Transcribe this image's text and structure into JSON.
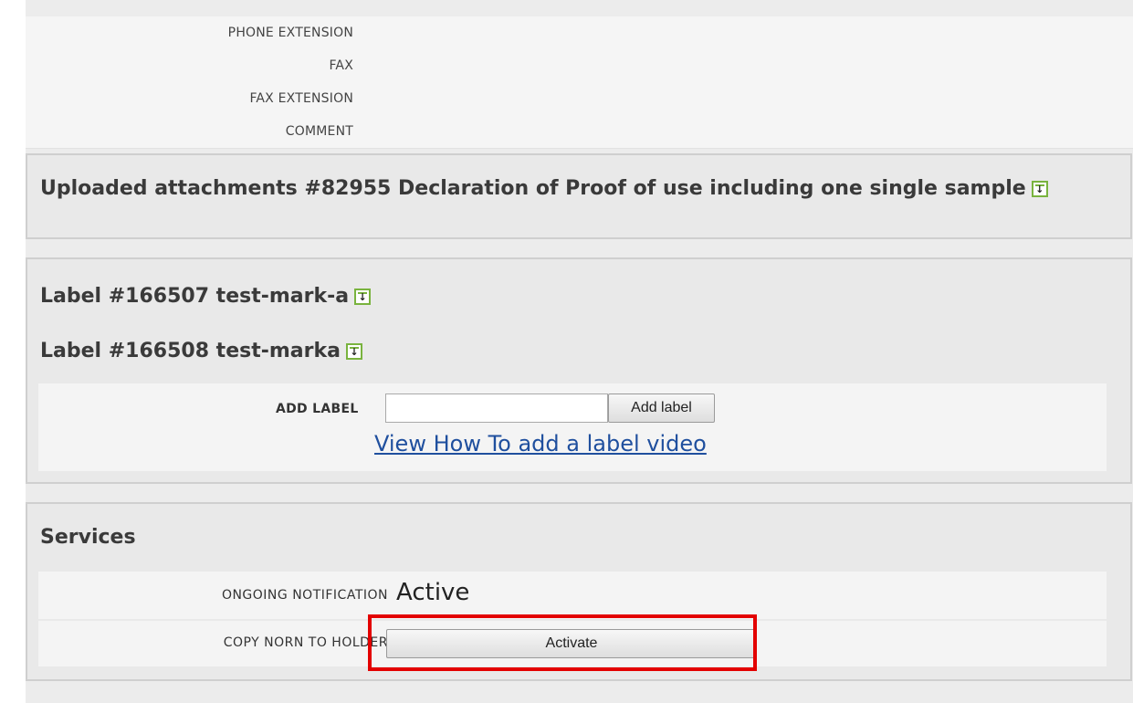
{
  "contact_fields": [
    {
      "label": "PHONE EXTENSION"
    },
    {
      "label": "FAX"
    },
    {
      "label": "FAX EXTENSION"
    },
    {
      "label": "COMMENT"
    }
  ],
  "attachments": {
    "title": "Uploaded attachments #82955 Declaration of Proof of use including one single sample",
    "download_icon": "download-icon"
  },
  "labels": {
    "items": [
      {
        "text": "Label #166507 test-mark-a",
        "icon": "download-icon"
      },
      {
        "text": "Label #166508 test-marka",
        "icon": "download-icon"
      }
    ],
    "add_label_field": "ADD LABEL",
    "add_label_input_value": "",
    "add_label_button": "Add label",
    "video_link": "View How To add a label video"
  },
  "services": {
    "title": "Services",
    "rows": [
      {
        "label": "ONGOING NOTIFICATION",
        "value": "Active"
      },
      {
        "label": "COPY NORN TO HOLDER",
        "button": "Activate"
      }
    ]
  },
  "colors": {
    "highlight": "#e30000",
    "download_icon": "#79b33e",
    "link": "#1f4f9e"
  }
}
